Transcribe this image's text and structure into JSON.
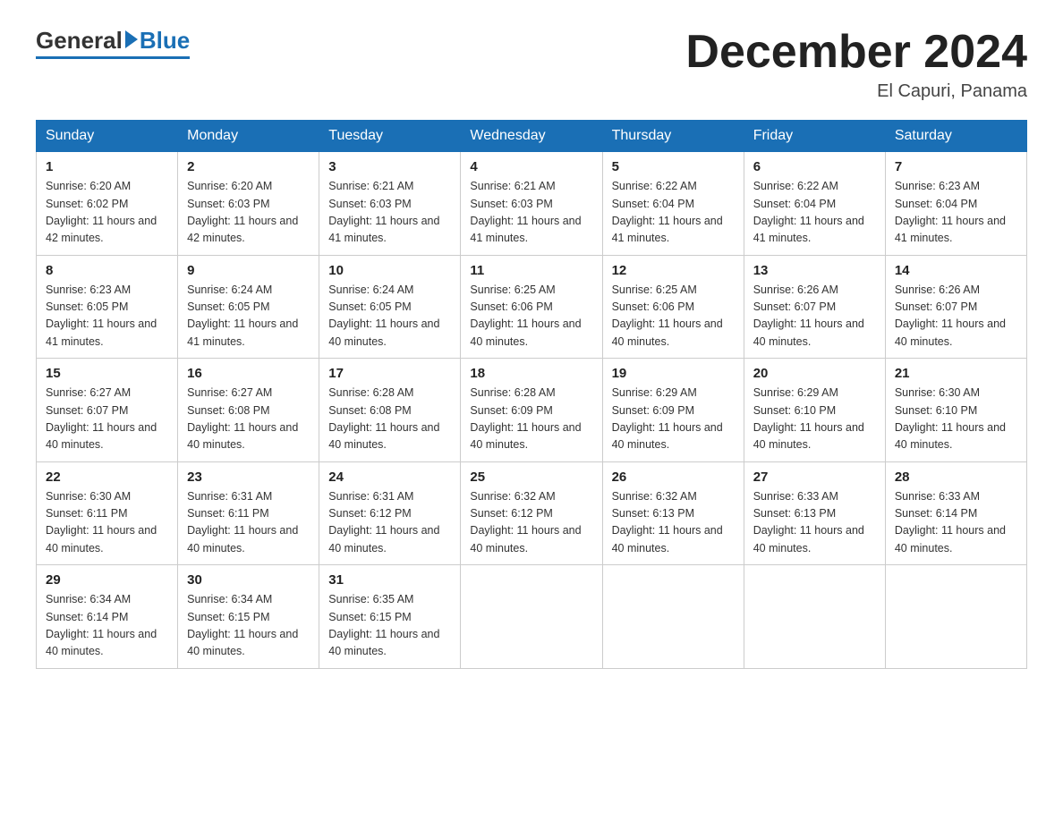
{
  "header": {
    "logo_general": "General",
    "logo_blue": "Blue",
    "month_title": "December 2024",
    "location": "El Capuri, Panama"
  },
  "days_of_week": [
    "Sunday",
    "Monday",
    "Tuesday",
    "Wednesday",
    "Thursday",
    "Friday",
    "Saturday"
  ],
  "weeks": [
    [
      {
        "day": 1,
        "sunrise": "6:20 AM",
        "sunset": "6:02 PM",
        "daylight": "11 hours and 42 minutes."
      },
      {
        "day": 2,
        "sunrise": "6:20 AM",
        "sunset": "6:03 PM",
        "daylight": "11 hours and 42 minutes."
      },
      {
        "day": 3,
        "sunrise": "6:21 AM",
        "sunset": "6:03 PM",
        "daylight": "11 hours and 41 minutes."
      },
      {
        "day": 4,
        "sunrise": "6:21 AM",
        "sunset": "6:03 PM",
        "daylight": "11 hours and 41 minutes."
      },
      {
        "day": 5,
        "sunrise": "6:22 AM",
        "sunset": "6:04 PM",
        "daylight": "11 hours and 41 minutes."
      },
      {
        "day": 6,
        "sunrise": "6:22 AM",
        "sunset": "6:04 PM",
        "daylight": "11 hours and 41 minutes."
      },
      {
        "day": 7,
        "sunrise": "6:23 AM",
        "sunset": "6:04 PM",
        "daylight": "11 hours and 41 minutes."
      }
    ],
    [
      {
        "day": 8,
        "sunrise": "6:23 AM",
        "sunset": "6:05 PM",
        "daylight": "11 hours and 41 minutes."
      },
      {
        "day": 9,
        "sunrise": "6:24 AM",
        "sunset": "6:05 PM",
        "daylight": "11 hours and 41 minutes."
      },
      {
        "day": 10,
        "sunrise": "6:24 AM",
        "sunset": "6:05 PM",
        "daylight": "11 hours and 40 minutes."
      },
      {
        "day": 11,
        "sunrise": "6:25 AM",
        "sunset": "6:06 PM",
        "daylight": "11 hours and 40 minutes."
      },
      {
        "day": 12,
        "sunrise": "6:25 AM",
        "sunset": "6:06 PM",
        "daylight": "11 hours and 40 minutes."
      },
      {
        "day": 13,
        "sunrise": "6:26 AM",
        "sunset": "6:07 PM",
        "daylight": "11 hours and 40 minutes."
      },
      {
        "day": 14,
        "sunrise": "6:26 AM",
        "sunset": "6:07 PM",
        "daylight": "11 hours and 40 minutes."
      }
    ],
    [
      {
        "day": 15,
        "sunrise": "6:27 AM",
        "sunset": "6:07 PM",
        "daylight": "11 hours and 40 minutes."
      },
      {
        "day": 16,
        "sunrise": "6:27 AM",
        "sunset": "6:08 PM",
        "daylight": "11 hours and 40 minutes."
      },
      {
        "day": 17,
        "sunrise": "6:28 AM",
        "sunset": "6:08 PM",
        "daylight": "11 hours and 40 minutes."
      },
      {
        "day": 18,
        "sunrise": "6:28 AM",
        "sunset": "6:09 PM",
        "daylight": "11 hours and 40 minutes."
      },
      {
        "day": 19,
        "sunrise": "6:29 AM",
        "sunset": "6:09 PM",
        "daylight": "11 hours and 40 minutes."
      },
      {
        "day": 20,
        "sunrise": "6:29 AM",
        "sunset": "6:10 PM",
        "daylight": "11 hours and 40 minutes."
      },
      {
        "day": 21,
        "sunrise": "6:30 AM",
        "sunset": "6:10 PM",
        "daylight": "11 hours and 40 minutes."
      }
    ],
    [
      {
        "day": 22,
        "sunrise": "6:30 AM",
        "sunset": "6:11 PM",
        "daylight": "11 hours and 40 minutes."
      },
      {
        "day": 23,
        "sunrise": "6:31 AM",
        "sunset": "6:11 PM",
        "daylight": "11 hours and 40 minutes."
      },
      {
        "day": 24,
        "sunrise": "6:31 AM",
        "sunset": "6:12 PM",
        "daylight": "11 hours and 40 minutes."
      },
      {
        "day": 25,
        "sunrise": "6:32 AM",
        "sunset": "6:12 PM",
        "daylight": "11 hours and 40 minutes."
      },
      {
        "day": 26,
        "sunrise": "6:32 AM",
        "sunset": "6:13 PM",
        "daylight": "11 hours and 40 minutes."
      },
      {
        "day": 27,
        "sunrise": "6:33 AM",
        "sunset": "6:13 PM",
        "daylight": "11 hours and 40 minutes."
      },
      {
        "day": 28,
        "sunrise": "6:33 AM",
        "sunset": "6:14 PM",
        "daylight": "11 hours and 40 minutes."
      }
    ],
    [
      {
        "day": 29,
        "sunrise": "6:34 AM",
        "sunset": "6:14 PM",
        "daylight": "11 hours and 40 minutes."
      },
      {
        "day": 30,
        "sunrise": "6:34 AM",
        "sunset": "6:15 PM",
        "daylight": "11 hours and 40 minutes."
      },
      {
        "day": 31,
        "sunrise": "6:35 AM",
        "sunset": "6:15 PM",
        "daylight": "11 hours and 40 minutes."
      },
      null,
      null,
      null,
      null
    ]
  ]
}
